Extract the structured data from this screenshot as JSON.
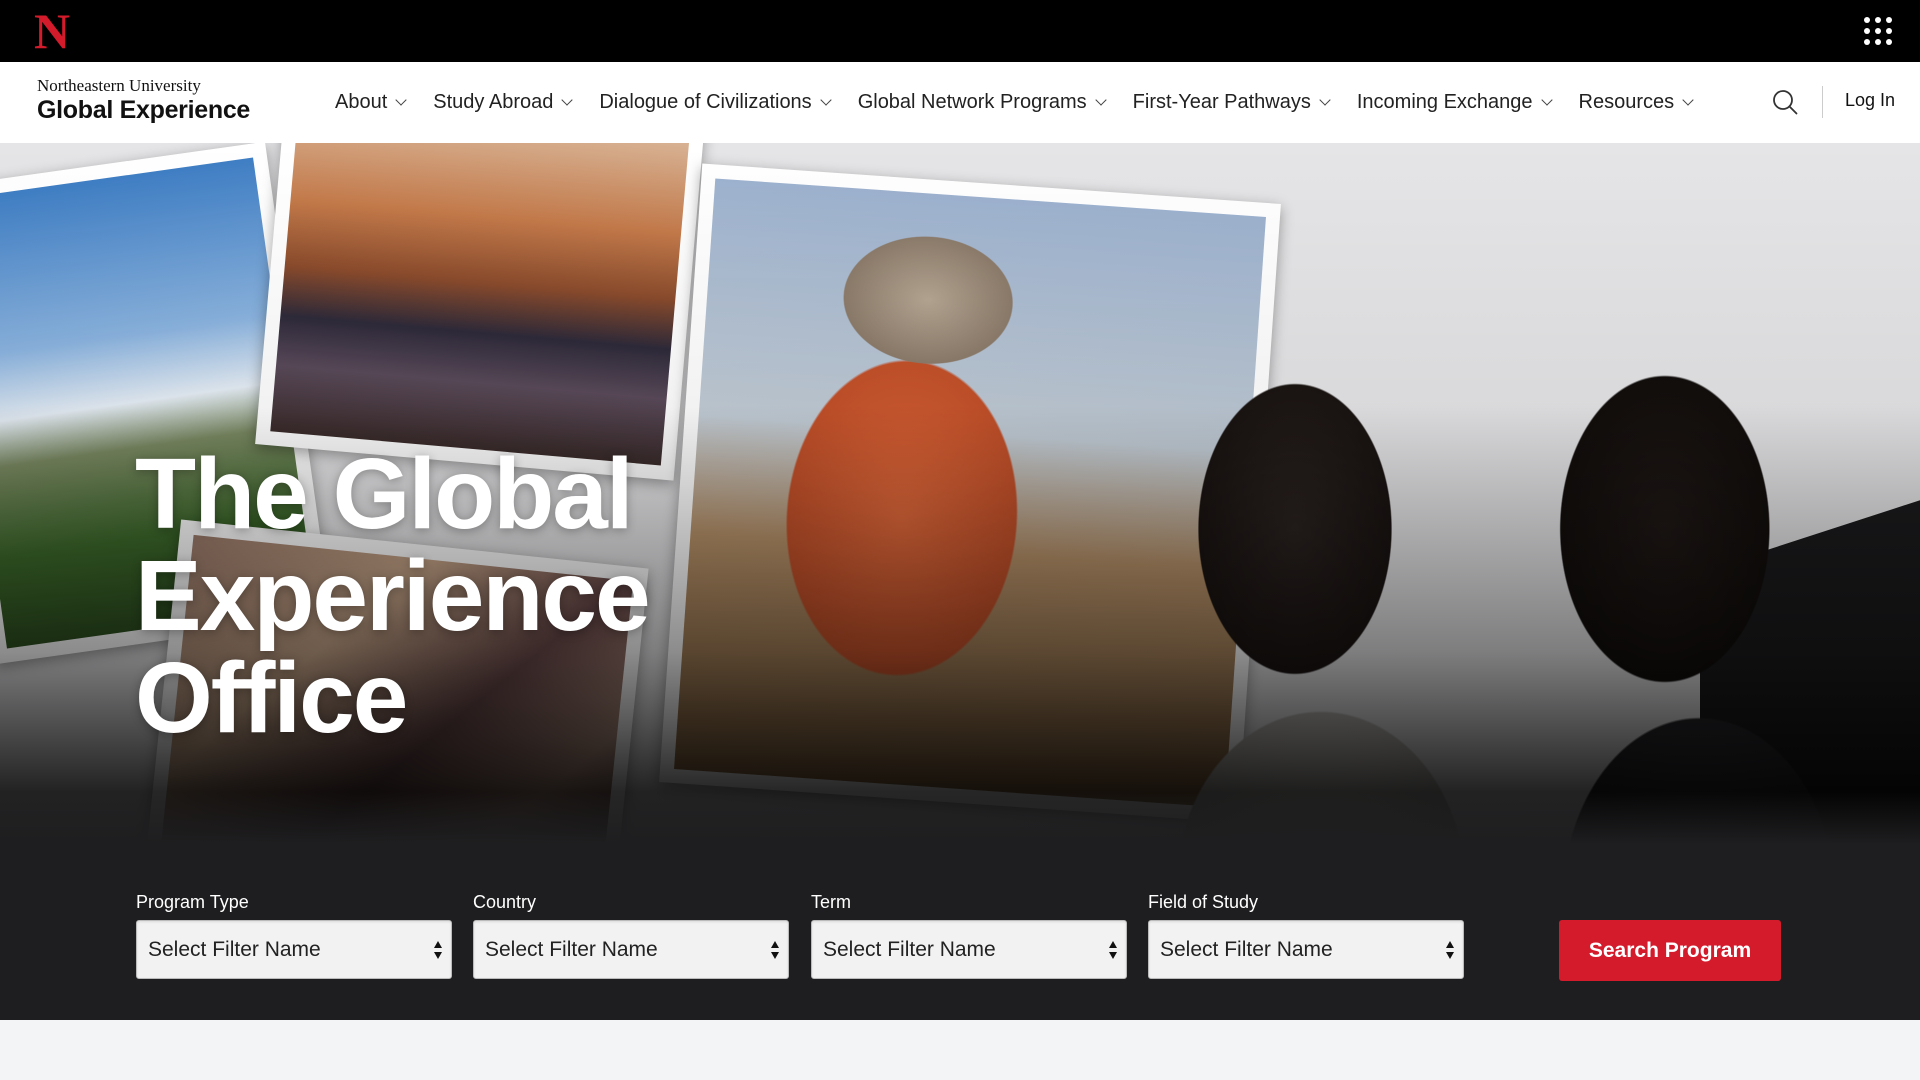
{
  "topbar": {
    "logo_letter": "N",
    "apps_icon": "grid-icon"
  },
  "brand": {
    "university": "Northeastern University",
    "name": "Global Experience"
  },
  "nav": {
    "items": [
      {
        "label": "About"
      },
      {
        "label": "Study Abroad"
      },
      {
        "label": "Dialogue of Civilizations"
      },
      {
        "label": "Global Network Programs"
      },
      {
        "label": "First-Year Pathways"
      },
      {
        "label": "Incoming Exchange"
      },
      {
        "label": "Resources"
      }
    ],
    "login": "Log In"
  },
  "hero": {
    "title_line1": "The Global",
    "title_line2": "Experience",
    "title_line3": "Office"
  },
  "filters": [
    {
      "label": "Program Type",
      "value": "Select Filter Name"
    },
    {
      "label": "Country",
      "value": "Select Filter Name"
    },
    {
      "label": "Term",
      "value": "Select Filter Name"
    },
    {
      "label": "Field of Study",
      "value": "Select Filter Name"
    }
  ],
  "search_button": "Search Program",
  "colors": {
    "brand_red": "#d41b2c",
    "topbar": "#000000",
    "hero_dark": "#1e1e20"
  }
}
